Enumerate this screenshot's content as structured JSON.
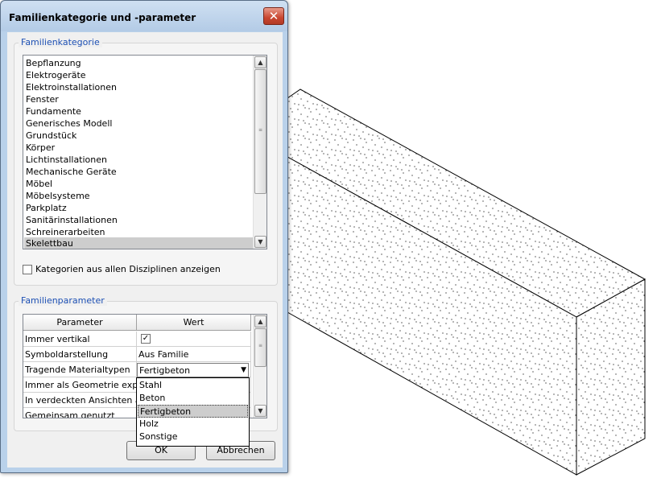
{
  "dialog": {
    "title": "Familienkategorie und -parameter",
    "close_glyph": "✕"
  },
  "category_group": {
    "label": "Familienkategorie",
    "items": [
      "Bepflanzung",
      "Elektrogeräte",
      "Elektroinstallationen",
      "Fenster",
      "Fundamente",
      "Generisches Modell",
      "Grundstück",
      "Körper",
      "Lichtinstallationen",
      "Mechanische Geräte",
      "Möbel",
      "Möbelsysteme",
      "Parkplatz",
      "Sanitärinstallationen",
      "Schreinerarbeiten",
      "Skelettbau"
    ],
    "selected": "Skelettbau",
    "show_all_label": "Kategorien aus allen Disziplinen anzeigen",
    "show_all_checked": false
  },
  "parameters_group": {
    "label": "Familienparameter",
    "columns": [
      "Parameter",
      "Wert"
    ],
    "rows": [
      {
        "name": "Immer vertikal",
        "value": "",
        "checked": true
      },
      {
        "name": "Symboldarstellung",
        "value": "Aus Familie"
      },
      {
        "name": "Tragende Materialtypen",
        "value": "Fertigbeton"
      },
      {
        "name": "Immer als Geometrie expo",
        "value": ""
      },
      {
        "name": "In verdeckten Ansichten a",
        "value": ""
      },
      {
        "name": "Gemeinsam genutzt",
        "value": ""
      }
    ],
    "dropdown_options": [
      "Stahl",
      "Beton",
      "Fertigbeton",
      "Holz",
      "Sonstige"
    ],
    "dropdown_selected": "Fertigbeton"
  },
  "buttons": {
    "ok": "OK",
    "cancel": "Abbrechen"
  },
  "icons": {
    "close": "close-icon",
    "scroll_up": "chevron-up-icon",
    "scroll_down": "chevron-down-icon",
    "combo": "chevron-down-icon",
    "check": "checkmark-icon"
  },
  "colors": {
    "group_label": "#1d50b4",
    "close_button": "#c94630",
    "dialog_frame": "#b9d1ea",
    "selection": "#cdcdcd",
    "beam_stipple": "#000000"
  }
}
